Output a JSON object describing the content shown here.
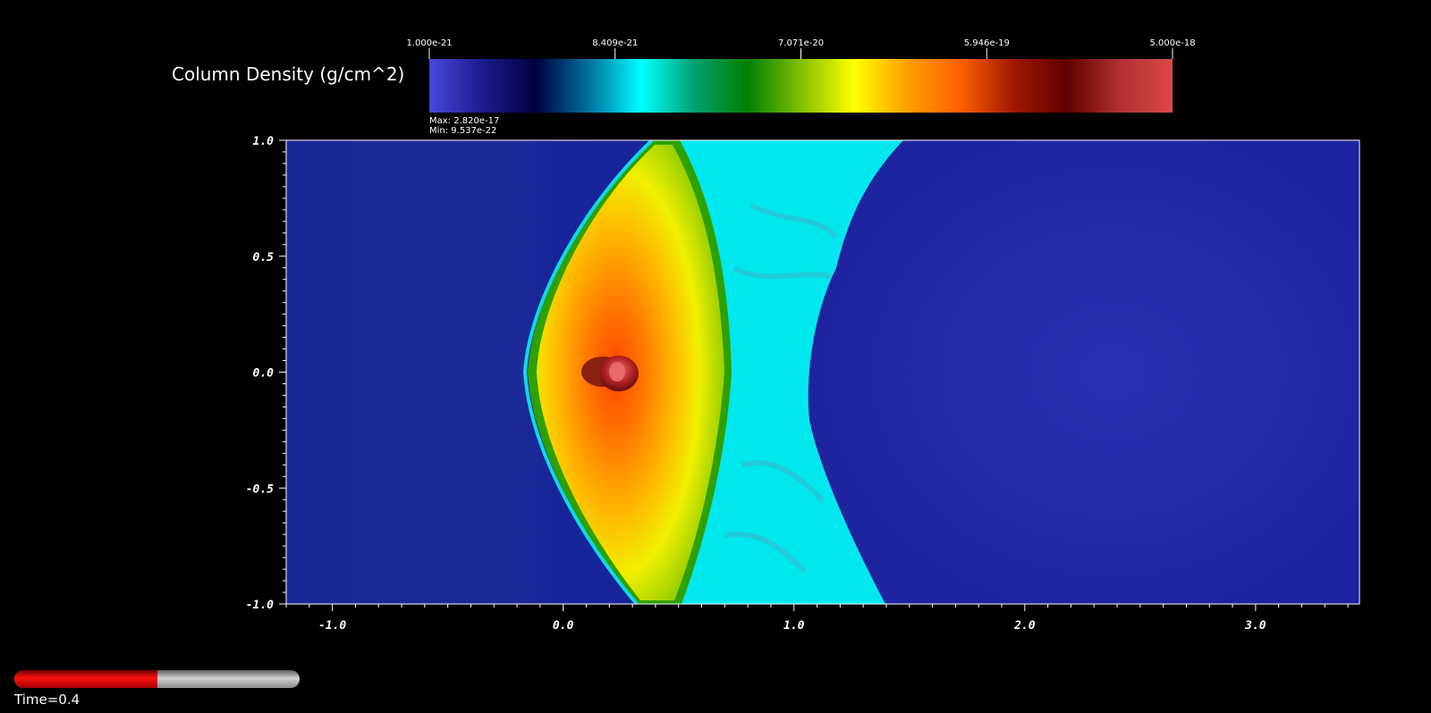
{
  "colorbar": {
    "title": "Column Density (g/cm^2)",
    "tick_labels": [
      "1.000e-21",
      "8.409e-21",
      "7.071e-20",
      "5.946e-19",
      "5.000e-18"
    ],
    "max_label": "Max:  2.820e-17",
    "min_label": "Min:  9.537e-22",
    "colors": [
      "#4848dc",
      "#1c1c8c",
      "#000040",
      "#0070a0",
      "#00ffff",
      "#00a070",
      "#008000",
      "#80c000",
      "#ffff00",
      "#ffa000",
      "#ff6000",
      "#a01800",
      "#600000",
      "#b03030",
      "#dc4848"
    ]
  },
  "chart_data": {
    "type": "heatmap",
    "title": "",
    "xlabel": "",
    "ylabel": "",
    "xlim": [
      -1.2,
      3.45
    ],
    "ylim": [
      -1.0,
      1.0
    ],
    "x_ticks": [
      -1.0,
      0.0,
      1.0,
      2.0,
      3.0
    ],
    "x_tick_labels": [
      "-1.0",
      "0.0",
      "1.0",
      "2.0",
      "3.0"
    ],
    "y_ticks": [
      1.0,
      0.5,
      0.0,
      -0.5,
      -1.0
    ],
    "y_tick_labels": [
      "1.0",
      "0.5",
      "0.0",
      "-0.5",
      "-1.0"
    ],
    "value_range": [
      1e-21,
      5e-18
    ],
    "value_scale": "log",
    "data_max": 2.82e-17,
    "data_min": 9.537e-22,
    "grid": false,
    "features": {
      "bow_shock_apex": [
        -0.15,
        0.0
      ],
      "clump_center": [
        0.25,
        0.0
      ]
    }
  },
  "time": {
    "label": "Time=0.4",
    "progress": 0.5
  }
}
